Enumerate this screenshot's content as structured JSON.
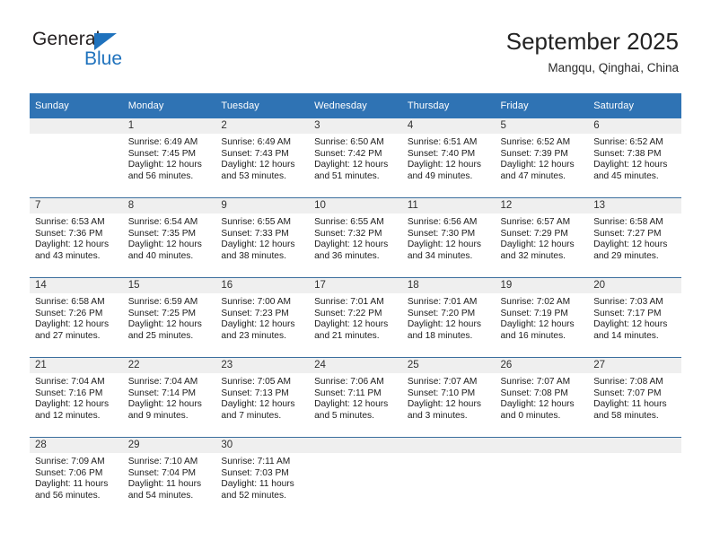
{
  "brand": {
    "name_top": "General",
    "name_bottom": "Blue",
    "logo_icon": "triangle-icon",
    "accent_color": "#1f72bd"
  },
  "header": {
    "title": "September 2025",
    "subtitle": "Mangqu, Qinghai, China"
  },
  "calendar": {
    "header_color": "#2f73b4",
    "daynum_band_color": "#efefef",
    "weekday_headers": [
      "Sunday",
      "Monday",
      "Tuesday",
      "Wednesday",
      "Thursday",
      "Friday",
      "Saturday"
    ],
    "labels": {
      "sunrise": "Sunrise:",
      "sunset": "Sunset:",
      "daylight": "Daylight:"
    },
    "weeks": [
      [
        {
          "day": "",
          "empty": true
        },
        {
          "day": "1",
          "sunrise": "Sunrise: 6:49 AM",
          "sunset": "Sunset: 7:45 PM",
          "daylight_1": "Daylight: 12 hours",
          "daylight_2": "and 56 minutes."
        },
        {
          "day": "2",
          "sunrise": "Sunrise: 6:49 AM",
          "sunset": "Sunset: 7:43 PM",
          "daylight_1": "Daylight: 12 hours",
          "daylight_2": "and 53 minutes."
        },
        {
          "day": "3",
          "sunrise": "Sunrise: 6:50 AM",
          "sunset": "Sunset: 7:42 PM",
          "daylight_1": "Daylight: 12 hours",
          "daylight_2": "and 51 minutes."
        },
        {
          "day": "4",
          "sunrise": "Sunrise: 6:51 AM",
          "sunset": "Sunset: 7:40 PM",
          "daylight_1": "Daylight: 12 hours",
          "daylight_2": "and 49 minutes."
        },
        {
          "day": "5",
          "sunrise": "Sunrise: 6:52 AM",
          "sunset": "Sunset: 7:39 PM",
          "daylight_1": "Daylight: 12 hours",
          "daylight_2": "and 47 minutes."
        },
        {
          "day": "6",
          "sunrise": "Sunrise: 6:52 AM",
          "sunset": "Sunset: 7:38 PM",
          "daylight_1": "Daylight: 12 hours",
          "daylight_2": "and 45 minutes."
        }
      ],
      [
        {
          "day": "7",
          "sunrise": "Sunrise: 6:53 AM",
          "sunset": "Sunset: 7:36 PM",
          "daylight_1": "Daylight: 12 hours",
          "daylight_2": "and 43 minutes."
        },
        {
          "day": "8",
          "sunrise": "Sunrise: 6:54 AM",
          "sunset": "Sunset: 7:35 PM",
          "daylight_1": "Daylight: 12 hours",
          "daylight_2": "and 40 minutes."
        },
        {
          "day": "9",
          "sunrise": "Sunrise: 6:55 AM",
          "sunset": "Sunset: 7:33 PM",
          "daylight_1": "Daylight: 12 hours",
          "daylight_2": "and 38 minutes."
        },
        {
          "day": "10",
          "sunrise": "Sunrise: 6:55 AM",
          "sunset": "Sunset: 7:32 PM",
          "daylight_1": "Daylight: 12 hours",
          "daylight_2": "and 36 minutes."
        },
        {
          "day": "11",
          "sunrise": "Sunrise: 6:56 AM",
          "sunset": "Sunset: 7:30 PM",
          "daylight_1": "Daylight: 12 hours",
          "daylight_2": "and 34 minutes."
        },
        {
          "day": "12",
          "sunrise": "Sunrise: 6:57 AM",
          "sunset": "Sunset: 7:29 PM",
          "daylight_1": "Daylight: 12 hours",
          "daylight_2": "and 32 minutes."
        },
        {
          "day": "13",
          "sunrise": "Sunrise: 6:58 AM",
          "sunset": "Sunset: 7:27 PM",
          "daylight_1": "Daylight: 12 hours",
          "daylight_2": "and 29 minutes."
        }
      ],
      [
        {
          "day": "14",
          "sunrise": "Sunrise: 6:58 AM",
          "sunset": "Sunset: 7:26 PM",
          "daylight_1": "Daylight: 12 hours",
          "daylight_2": "and 27 minutes."
        },
        {
          "day": "15",
          "sunrise": "Sunrise: 6:59 AM",
          "sunset": "Sunset: 7:25 PM",
          "daylight_1": "Daylight: 12 hours",
          "daylight_2": "and 25 minutes."
        },
        {
          "day": "16",
          "sunrise": "Sunrise: 7:00 AM",
          "sunset": "Sunset: 7:23 PM",
          "daylight_1": "Daylight: 12 hours",
          "daylight_2": "and 23 minutes."
        },
        {
          "day": "17",
          "sunrise": "Sunrise: 7:01 AM",
          "sunset": "Sunset: 7:22 PM",
          "daylight_1": "Daylight: 12 hours",
          "daylight_2": "and 21 minutes."
        },
        {
          "day": "18",
          "sunrise": "Sunrise: 7:01 AM",
          "sunset": "Sunset: 7:20 PM",
          "daylight_1": "Daylight: 12 hours",
          "daylight_2": "and 18 minutes."
        },
        {
          "day": "19",
          "sunrise": "Sunrise: 7:02 AM",
          "sunset": "Sunset: 7:19 PM",
          "daylight_1": "Daylight: 12 hours",
          "daylight_2": "and 16 minutes."
        },
        {
          "day": "20",
          "sunrise": "Sunrise: 7:03 AM",
          "sunset": "Sunset: 7:17 PM",
          "daylight_1": "Daylight: 12 hours",
          "daylight_2": "and 14 minutes."
        }
      ],
      [
        {
          "day": "21",
          "sunrise": "Sunrise: 7:04 AM",
          "sunset": "Sunset: 7:16 PM",
          "daylight_1": "Daylight: 12 hours",
          "daylight_2": "and 12 minutes."
        },
        {
          "day": "22",
          "sunrise": "Sunrise: 7:04 AM",
          "sunset": "Sunset: 7:14 PM",
          "daylight_1": "Daylight: 12 hours",
          "daylight_2": "and 9 minutes."
        },
        {
          "day": "23",
          "sunrise": "Sunrise: 7:05 AM",
          "sunset": "Sunset: 7:13 PM",
          "daylight_1": "Daylight: 12 hours",
          "daylight_2": "and 7 minutes."
        },
        {
          "day": "24",
          "sunrise": "Sunrise: 7:06 AM",
          "sunset": "Sunset: 7:11 PM",
          "daylight_1": "Daylight: 12 hours",
          "daylight_2": "and 5 minutes."
        },
        {
          "day": "25",
          "sunrise": "Sunrise: 7:07 AM",
          "sunset": "Sunset: 7:10 PM",
          "daylight_1": "Daylight: 12 hours",
          "daylight_2": "and 3 minutes."
        },
        {
          "day": "26",
          "sunrise": "Sunrise: 7:07 AM",
          "sunset": "Sunset: 7:08 PM",
          "daylight_1": "Daylight: 12 hours",
          "daylight_2": "and 0 minutes."
        },
        {
          "day": "27",
          "sunrise": "Sunrise: 7:08 AM",
          "sunset": "Sunset: 7:07 PM",
          "daylight_1": "Daylight: 11 hours",
          "daylight_2": "and 58 minutes."
        }
      ],
      [
        {
          "day": "28",
          "sunrise": "Sunrise: 7:09 AM",
          "sunset": "Sunset: 7:06 PM",
          "daylight_1": "Daylight: 11 hours",
          "daylight_2": "and 56 minutes."
        },
        {
          "day": "29",
          "sunrise": "Sunrise: 7:10 AM",
          "sunset": "Sunset: 7:04 PM",
          "daylight_1": "Daylight: 11 hours",
          "daylight_2": "and 54 minutes."
        },
        {
          "day": "30",
          "sunrise": "Sunrise: 7:11 AM",
          "sunset": "Sunset: 7:03 PM",
          "daylight_1": "Daylight: 11 hours",
          "daylight_2": "and 52 minutes."
        },
        {
          "day": "",
          "empty": true
        },
        {
          "day": "",
          "empty": true
        },
        {
          "day": "",
          "empty": true
        },
        {
          "day": "",
          "empty": true
        }
      ]
    ]
  }
}
